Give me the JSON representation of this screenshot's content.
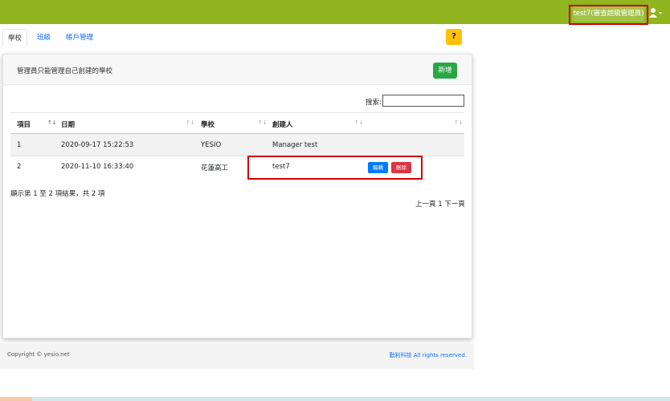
{
  "header": {
    "user_label": "test7(審查超級管理員)",
    "user_icon": "user-icon",
    "dropdown_icon": "caret-down-icon",
    "brand_color": "#91b51f"
  },
  "tabs": [
    {
      "label": "學校",
      "active": true
    },
    {
      "label": "班級",
      "active": false
    },
    {
      "label": "帳戶管理",
      "active": false
    }
  ],
  "help_label": "?",
  "panel": {
    "title": "管理員只能管理自己創建的學校",
    "add_label": "新增"
  },
  "search": {
    "label": "搜索:",
    "value": ""
  },
  "table": {
    "headers": [
      "項目",
      "日期",
      "學校",
      "創建人"
    ],
    "rows": [
      {
        "id": "1",
        "date": "2020-09-17 15:22:53",
        "school": "YESIO",
        "creator": "Manager test"
      },
      {
        "id": "2",
        "date": "2020-11-10 16:33:40",
        "school": "花蓮高工",
        "creator": "test7",
        "edit_label": "編輯",
        "delete_label": "刪除"
      }
    ]
  },
  "info_text": "顯示第 1 至 2 項結果，共 2 項",
  "pager_text": "上一頁 1 下一頁",
  "footer": {
    "copyright": "Copyright © yesio.net",
    "company": "勤利科技 All rights reserved."
  }
}
